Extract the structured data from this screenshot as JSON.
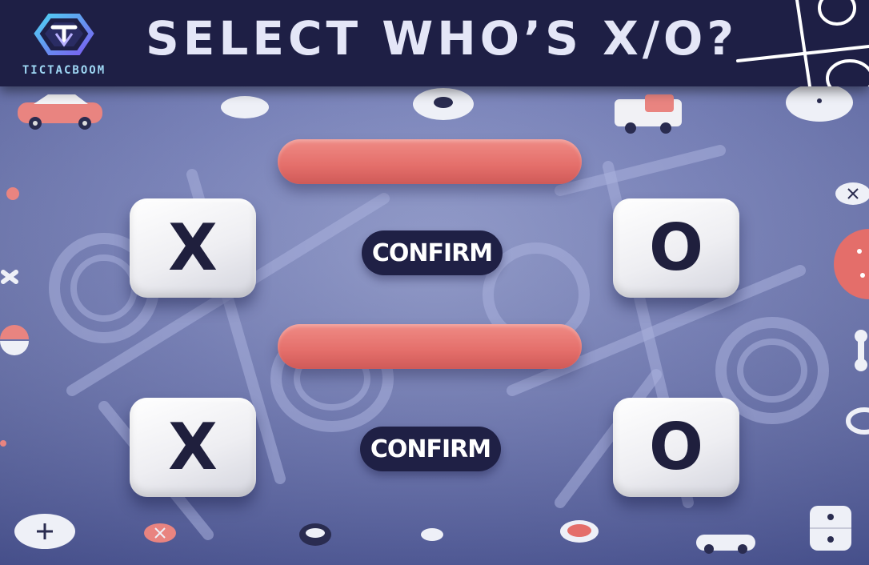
{
  "header": {
    "logo_text": "TICTACBOOM",
    "title": "SELECT WHO’S X/O?"
  },
  "rows": [
    {
      "left_key": "X",
      "right_key": "O",
      "confirm_label": "CONFIRM"
    },
    {
      "left_key": "X",
      "right_key": "O",
      "confirm_label": "CONFIRM"
    }
  ],
  "colors": {
    "header_bg": "#1e1f45",
    "title": "#e4e6f7",
    "bar": "#e46e6a",
    "confirm_bg": "#1f2045",
    "key_face": "#f2f2f5",
    "background": "#6f79b3"
  },
  "icons": [
    "logo-icon",
    "tictactoe-grid-icon",
    "car-icon",
    "van-icon",
    "plus-button-icon",
    "x-token-icon",
    "o-token-icon"
  ]
}
